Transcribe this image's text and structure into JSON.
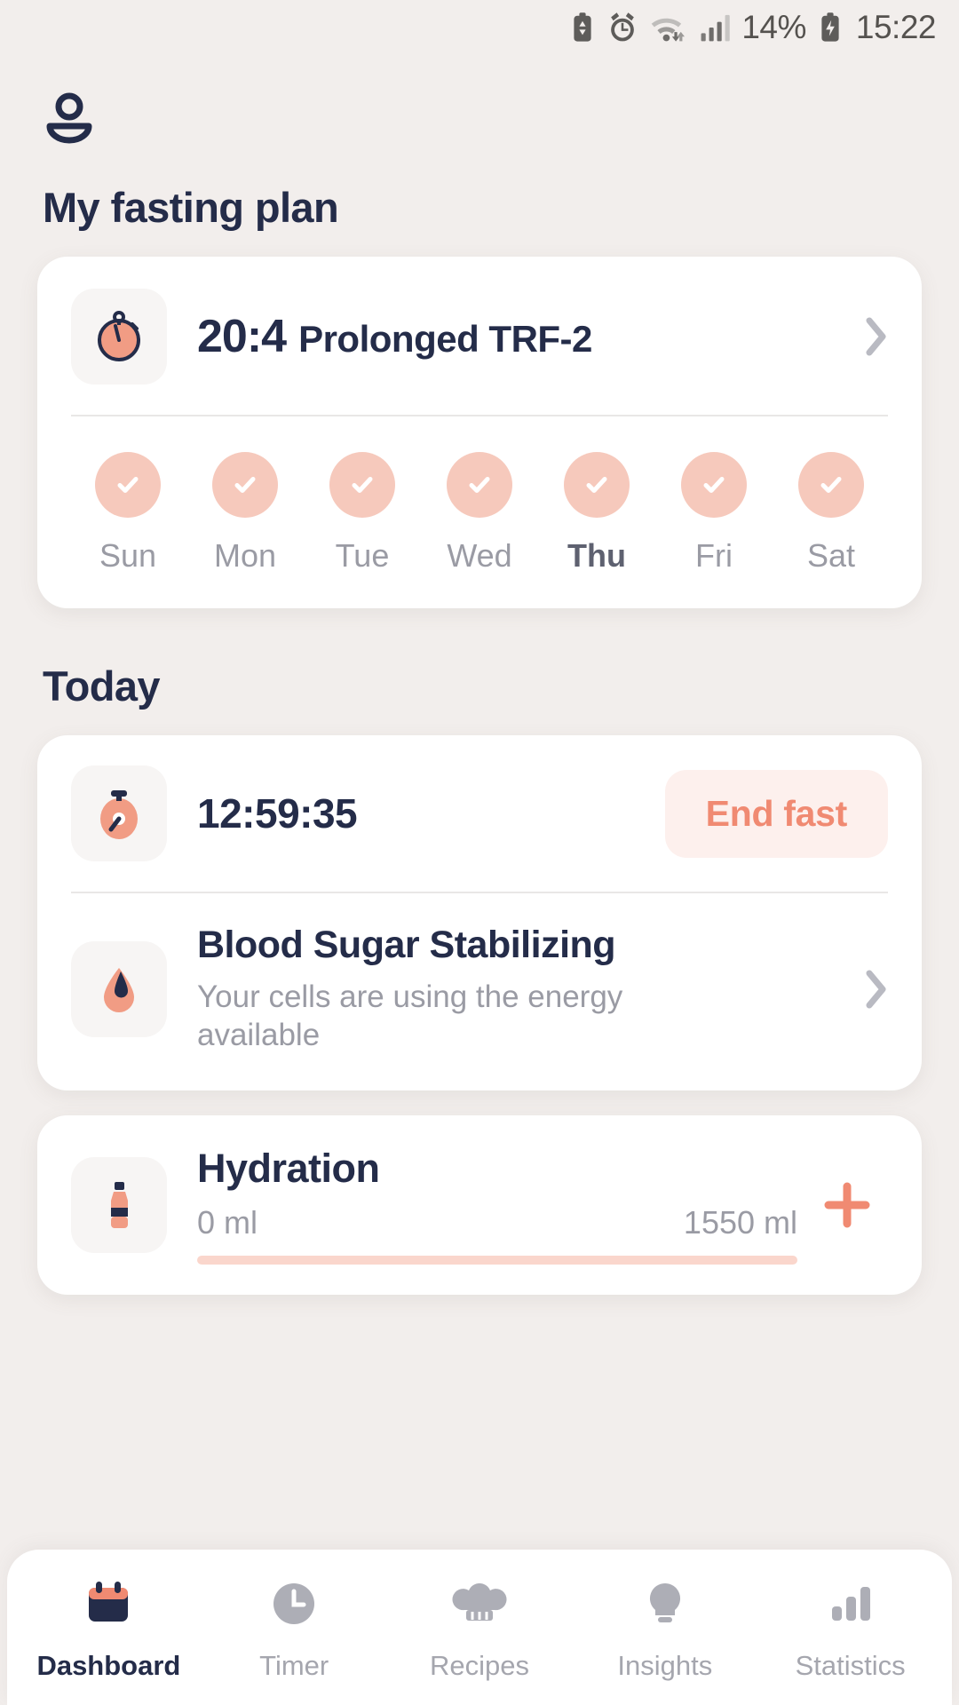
{
  "statusbar": {
    "icons": [
      "battery-saver-icon",
      "alarm-icon",
      "wifi-icon",
      "signal-icon"
    ],
    "battery_percent": "14%",
    "battery_icon": "battery-charging-icon",
    "clock": "15:22"
  },
  "header": {
    "avatar_icon": "profile-avatar-icon"
  },
  "plan_section": {
    "title": "My fasting plan",
    "icon": "stopwatch-icon",
    "ratio": "20:4",
    "name": "Prolonged TRF-2",
    "chevron_icon": "chevron-right-icon",
    "days": [
      {
        "label": "Sun",
        "checked": true,
        "today": false
      },
      {
        "label": "Mon",
        "checked": true,
        "today": false
      },
      {
        "label": "Tue",
        "checked": true,
        "today": false
      },
      {
        "label": "Wed",
        "checked": true,
        "today": false
      },
      {
        "label": "Thu",
        "checked": true,
        "today": true
      },
      {
        "label": "Fri",
        "checked": true,
        "today": false
      },
      {
        "label": "Sat",
        "checked": true,
        "today": false
      }
    ]
  },
  "today_section": {
    "title": "Today",
    "timer": {
      "icon": "stopwatch-filled-icon",
      "value": "12:59:35",
      "action_label": "End fast"
    },
    "stage": {
      "icon": "blood-drop-icon",
      "title": "Blood Sugar Stabilizing",
      "subtitle": "Your cells are using the energy available",
      "chevron_icon": "chevron-right-icon"
    }
  },
  "hydration": {
    "icon": "water-bottle-icon",
    "title": "Hydration",
    "current": "0 ml",
    "goal": "1550 ml",
    "progress_percent": 0,
    "add_icon": "plus-icon"
  },
  "bottom_nav": [
    {
      "label": "Dashboard",
      "icon": "calendar-icon",
      "active": true
    },
    {
      "label": "Timer",
      "icon": "clock-icon",
      "active": false
    },
    {
      "label": "Recipes",
      "icon": "chef-hat-icon",
      "active": false
    },
    {
      "label": "Insights",
      "icon": "lightbulb-icon",
      "active": false
    },
    {
      "label": "Statistics",
      "icon": "bar-chart-icon",
      "active": false
    }
  ],
  "colors": {
    "background": "#F2EEEC",
    "card": "#FFFFFF",
    "navy": "#242C49",
    "salmon": "#F08A72",
    "pink_soft": "#F6C9BC",
    "gray_text": "#9A9BA4"
  }
}
